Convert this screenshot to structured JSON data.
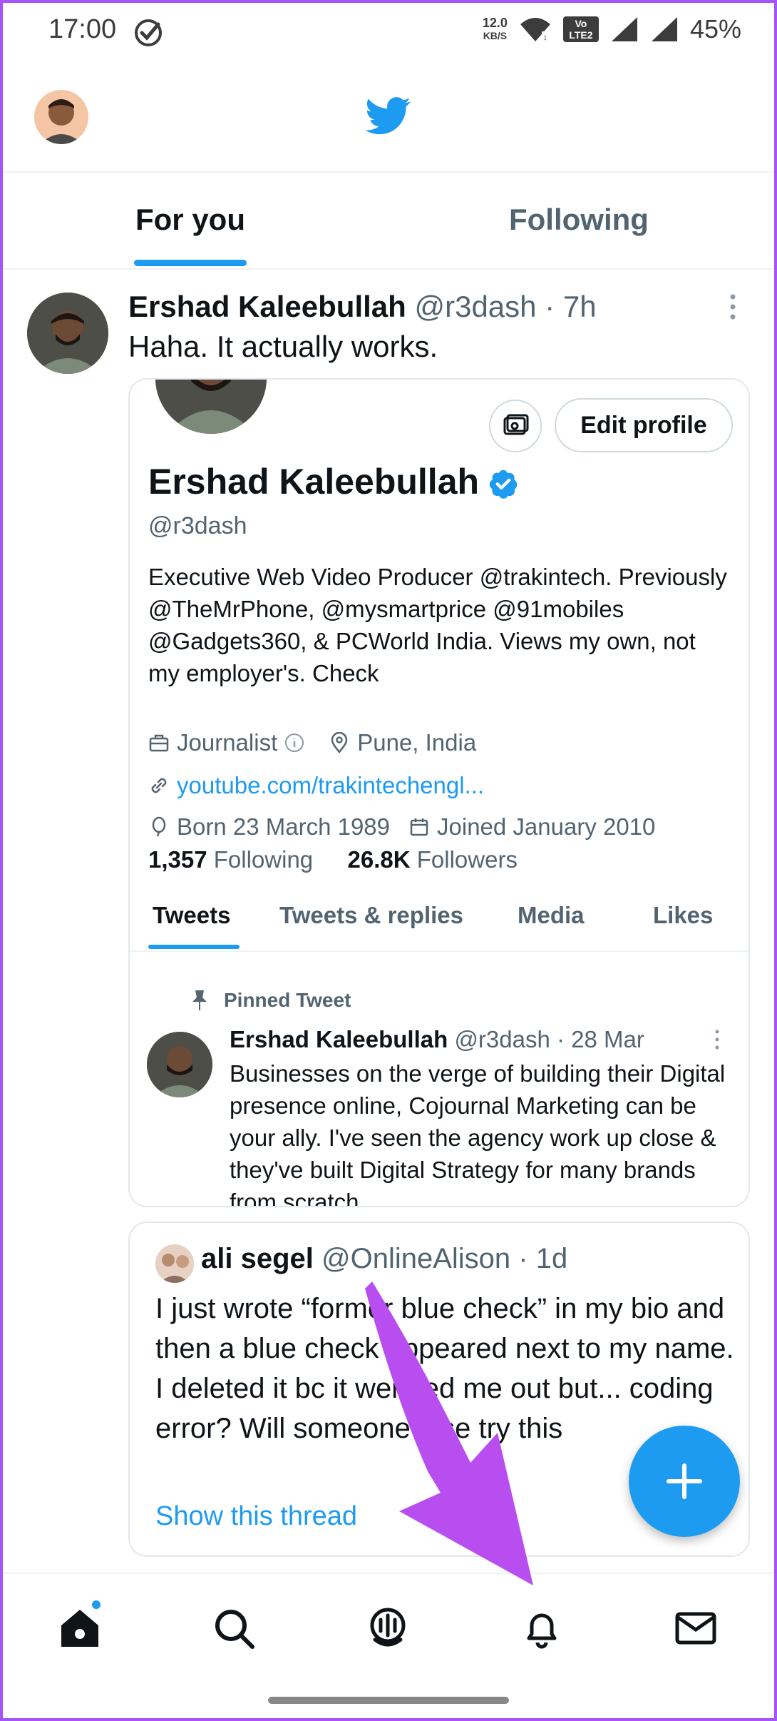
{
  "status_bar": {
    "time": "17:00",
    "speed_value": "12.0",
    "speed_unit": "KB/S",
    "volte_label": "Vo LTE2",
    "battery": "45%"
  },
  "tabs": {
    "for_you": "For you",
    "following": "Following"
  },
  "tweet": {
    "name": "Ershad Kaleebullah",
    "meta": "@r3dash · 7h",
    "text": "Haha. It actually works."
  },
  "profile_card": {
    "edit_profile": "Edit profile",
    "name": "Ershad Kaleebullah",
    "handle": "@r3dash",
    "bio": "Executive Web Video Producer @trakintech. Previously @TheMrPhone, @mysmartprice @91mobiles @Gadgets360, & PCWorld India. Views my own, not my employer's. Check",
    "category": "Journalist",
    "location": "Pune, India",
    "link": "youtube.com/trakintechengl...",
    "born": "Born 23 March 1989",
    "joined": "Joined January 2010",
    "following_count": "1,357",
    "following_label": "Following",
    "followers_count": "26.8K",
    "followers_label": "Followers",
    "tabs": [
      "Tweets",
      "Tweets & replies",
      "Media",
      "Likes"
    ],
    "pinned_label": "Pinned Tweet",
    "pinned_name": "Ershad Kaleebullah",
    "pinned_meta": "@r3dash · 28 Mar",
    "pinned_text": "Businesses on the verge of building their Digital presence online, Cojournal Marketing can be your ally. I've seen the agency work up close & they've built Digital Strategy for many brands from scratch."
  },
  "quoted": {
    "name": "ali segel",
    "meta": "@OnlineAlison · 1d",
    "text": "I just wrote “former blue check” in my bio and then a blue check appeared next to my name. I deleted it bc it weirded me out but... coding error? Will someone else try this",
    "show_thread": "Show this thread"
  },
  "colors": {
    "accent": "#1d9bf0",
    "annotation_arrow": "#b84ef0"
  },
  "nav": {
    "items": [
      "home-icon",
      "search-icon",
      "spaces-icon",
      "notifications-icon",
      "messages-icon"
    ]
  }
}
